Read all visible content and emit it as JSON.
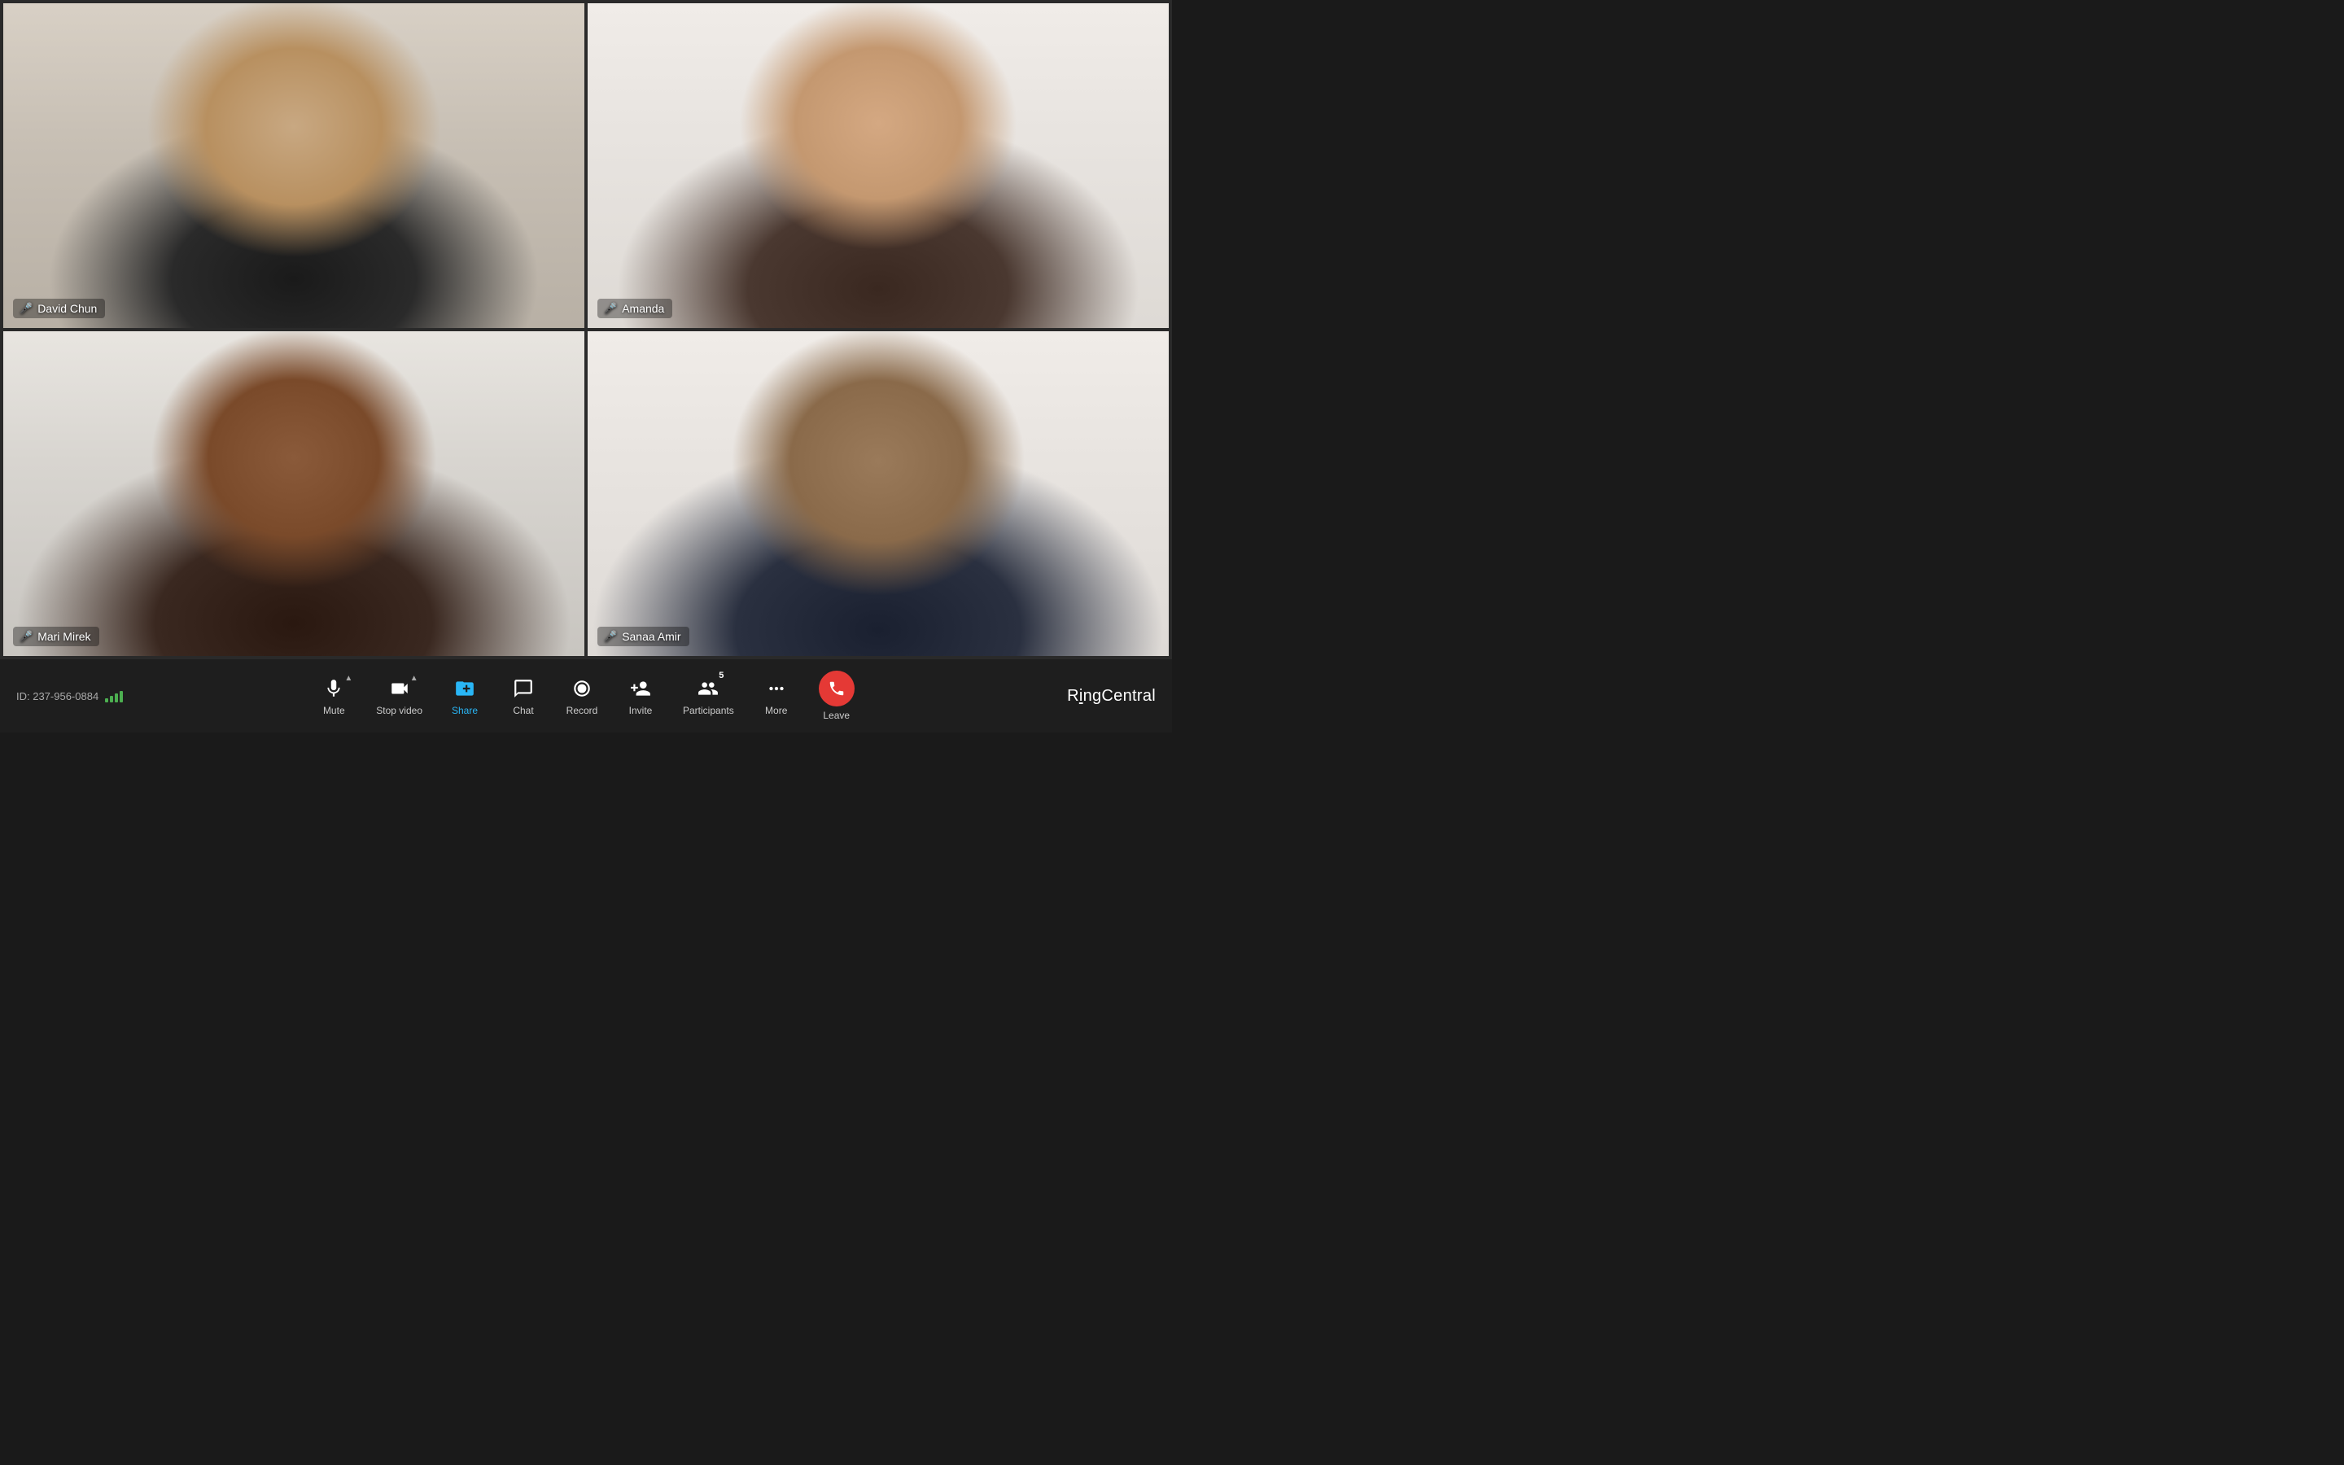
{
  "meeting": {
    "id": "ID: 237-956-0884"
  },
  "participants": [
    {
      "name": "David Chun",
      "mic_status": "active",
      "active_speaker": true,
      "position": "top-left"
    },
    {
      "name": "Amanda",
      "mic_status": "muted",
      "active_speaker": false,
      "position": "top-right"
    },
    {
      "name": "Mari Mirek",
      "mic_status": "active",
      "active_speaker": false,
      "position": "bottom-left"
    },
    {
      "name": "Sanaa Amir",
      "mic_status": "active",
      "active_speaker": false,
      "position": "bottom-right"
    }
  ],
  "toolbar": {
    "mute_label": "Mute",
    "stop_video_label": "Stop video",
    "share_label": "Share",
    "chat_label": "Chat",
    "record_label": "Record",
    "invite_label": "Invite",
    "participants_label": "Participants",
    "participants_count": "5",
    "more_label": "More",
    "leave_label": "Leave"
  },
  "branding": {
    "name": "RingCentral"
  }
}
